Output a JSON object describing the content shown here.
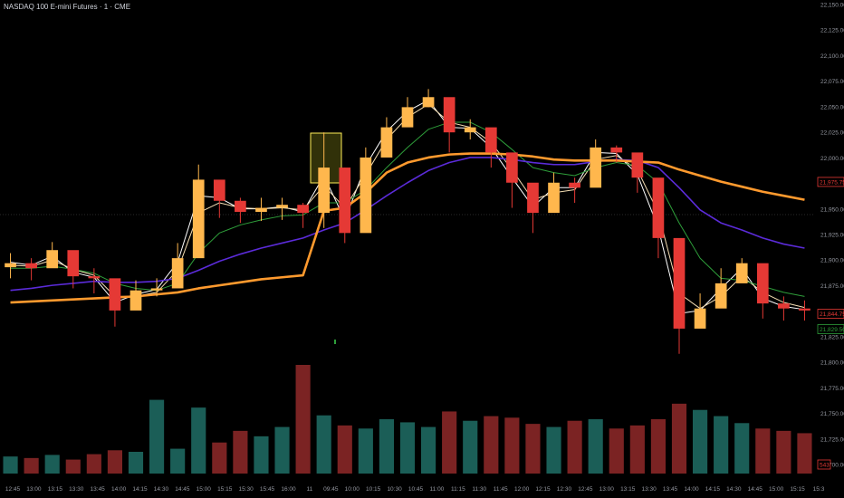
{
  "header": {
    "symbol_title": "NASDAQ 100 E-mini Futures · 1 · CME"
  },
  "colors": {
    "background": "#000000",
    "up_candle": "#ffb74d",
    "down_candle": "#e53935",
    "ema_fast": "#ffffff",
    "ema_mid": "#f5deb3",
    "ma_green": "#2e9e3a",
    "ma_blue": "#5b2bd9",
    "vwap_orange": "#ff9a2e",
    "vol_up": "#1b5e57",
    "vol_down": "#7b2323",
    "highlight_box": "#ffee58"
  },
  "price_badges": [
    {
      "value": "21,975.75",
      "color": "#e53935"
    },
    {
      "value": "21,844.75",
      "color": "#e53935"
    },
    {
      "value": "21,829.50",
      "color": "#2e9e3a"
    }
  ],
  "volume_badge": {
    "value": "543",
    "color": "#e53935"
  },
  "chart_data": {
    "type": "line",
    "title": "NASDAQ 100 E-mini Futures · 1 · CME",
    "x_tick_labels": [
      "12:45",
      "13:00",
      "13:15",
      "13:30",
      "13:45",
      "14:00",
      "14:15",
      "14:30",
      "14:45",
      "15:00",
      "15:15",
      "15:30",
      "15:45",
      "16:00",
      "11",
      "09:45",
      "10:00",
      "10:15",
      "10:30",
      "10:45",
      "11:00",
      "11:15",
      "11:30",
      "11:45",
      "12:00",
      "12:15",
      "12:30",
      "12:45",
      "13:00",
      "13:15",
      "13:30",
      "13:45",
      "14:00",
      "14:15",
      "14:30",
      "14:45",
      "15:00",
      "15:15",
      "15:3"
    ],
    "y_tick_labels": [
      "22,150.00",
      "22,125.00",
      "22,100.00",
      "22,075.00",
      "22,050.00",
      "22,025.00",
      "22,000.00",
      "21,975.00",
      "21,950.00",
      "21,925.00",
      "21,900.00",
      "21,875.00",
      "21,850.00",
      "21,825.00",
      "21,800.00",
      "21,775.00",
      "21,750.00",
      "21,725.00",
      "21,700.00"
    ],
    "y_range": [
      21695,
      22152
    ],
    "grid": false,
    "close_path": {
      "x": [
        "12:40",
        "12:55",
        "13:10",
        "13:25",
        "13:40",
        "13:55",
        "14:05",
        "14:20",
        "14:35",
        "14:50",
        "15:05",
        "15:20",
        "15:35",
        "15:50",
        "16:00",
        "09:35",
        "09:50",
        "10:05",
        "10:20",
        "10:35",
        "10:50",
        "11:05",
        "11:20",
        "11:35",
        "11:50",
        "12:05",
        "12:20",
        "12:35",
        "12:50",
        "13:05",
        "13:20",
        "13:35",
        "13:50",
        "14:05",
        "14:20",
        "14:35",
        "14:50",
        "15:05",
        "15:20"
      ],
      "close": [
        21895,
        21890,
        21908,
        21882,
        21880,
        21848,
        21868,
        21870,
        21900,
        21978,
        21957,
        21946,
        21950,
        21953,
        21945,
        21990,
        21925,
        22000,
        22030,
        22050,
        22060,
        22025,
        22030,
        22005,
        21975,
        21945,
        21975,
        21970,
        22010,
        22005,
        21980,
        21920,
        21830,
        21850,
        21875,
        21895,
        21855,
        21850,
        21848
      ],
      "high": [
        21905,
        21900,
        21916,
        21892,
        21890,
        21860,
        21878,
        21880,
        21915,
        21993,
        21975,
        21960,
        21960,
        21960,
        21955,
        22025,
        21990,
        22010,
        22040,
        22060,
        22068,
        22045,
        22038,
        22015,
        21990,
        21960,
        21985,
        21980,
        22018,
        22012,
        21992,
        21935,
        21840,
        21865,
        21890,
        21900,
        21870,
        21862,
        21858
      ],
      "low": [
        21880,
        21878,
        21895,
        21870,
        21865,
        21832,
        21855,
        21862,
        21885,
        21940,
        21940,
        21935,
        21937,
        21938,
        21930,
        21930,
        21915,
        21988,
        22020,
        22040,
        22050,
        22005,
        22018,
        21990,
        21950,
        21925,
        21960,
        21955,
        21998,
        21995,
        21965,
        21900,
        21805,
        21835,
        21860,
        21880,
        21840,
        21838,
        21838
      ]
    },
    "series": [
      {
        "values_ref": "ema_fast",
        "values": [
          21896,
          21893,
          21902,
          21886,
          21881,
          21856,
          21864,
          21869,
          21896,
          21962,
          21960,
          21949,
          21949,
          21951,
          21946,
          21982,
          21938,
          21992,
          22026,
          22046,
          22057,
          22030,
          22029,
          22010,
          21980,
          21951,
          21970,
          21970,
          22005,
          22004,
          21983,
          21930,
          21845,
          21848,
          21870,
          21890,
          21860,
          21852,
          21849
        ]
      },
      {
        "values_ref": "ema_mid",
        "values": [
          21893,
          21892,
          21898,
          21889,
          21883,
          21862,
          21862,
          21866,
          21888,
          21945,
          21955,
          21950,
          21949,
          21950,
          21948,
          21972,
          21950,
          21983,
          22018,
          22040,
          22053,
          22035,
          22030,
          22015,
          21988,
          21958,
          21965,
          21968,
          21998,
          22002,
          21988,
          21945,
          21865,
          21850,
          21862,
          21882,
          21866,
          21856,
          21851
        ]
      },
      {
        "values_ref": "ma_green",
        "values": [
          21890,
          21890,
          21892,
          21889,
          21885,
          21875,
          21870,
          21868,
          21875,
          21905,
          21925,
          21933,
          21938,
          21942,
          21943,
          21955,
          21955,
          21968,
          21990,
          22010,
          22028,
          22035,
          22035,
          22025,
          22008,
          21990,
          21985,
          21982,
          21990,
          21995,
          21992,
          21975,
          21935,
          21900,
          21880,
          21878,
          21872,
          21866,
          21862
        ]
      },
      {
        "values_ref": "ma_blue",
        "values": [
          21868,
          21870,
          21873,
          21875,
          21877,
          21876,
          21876,
          21877,
          21880,
          21888,
          21897,
          21904,
          21910,
          21915,
          21920,
          21928,
          21935,
          21948,
          21962,
          21975,
          21987,
          21995,
          22000,
          22000,
          21998,
          21995,
          21993,
          21993,
          21996,
          21998,
          21997,
          21990,
          21970,
          21948,
          21935,
          21928,
          21920,
          21914,
          21910
        ]
      },
      {
        "values_ref": "vwap_orange",
        "values": [
          21856,
          21857,
          21858,
          21859,
          21860,
          21861,
          21862,
          21864,
          21866,
          21870,
          21873,
          21876,
          21879,
          21881,
          21883,
          21947,
          21950,
          21965,
          21985,
          21995,
          22000,
          22003,
          22004,
          22004,
          22003,
          22001,
          21998,
          21997,
          21997,
          21997,
          21996,
          21995,
          21988,
          21982,
          21976,
          21971,
          21966,
          21962,
          21958
        ]
      }
    ],
    "volume": [
      22,
      20,
      24,
      18,
      25,
      30,
      28,
      95,
      32,
      85,
      40,
      55,
      48,
      60,
      140,
      75,
      62,
      58,
      70,
      66,
      60,
      80,
      68,
      74,
      72,
      64,
      60,
      68,
      70,
      58,
      62,
      70,
      90,
      82,
      74,
      65,
      58,
      55,
      52
    ],
    "xlabel": "",
    "ylabel": ""
  }
}
